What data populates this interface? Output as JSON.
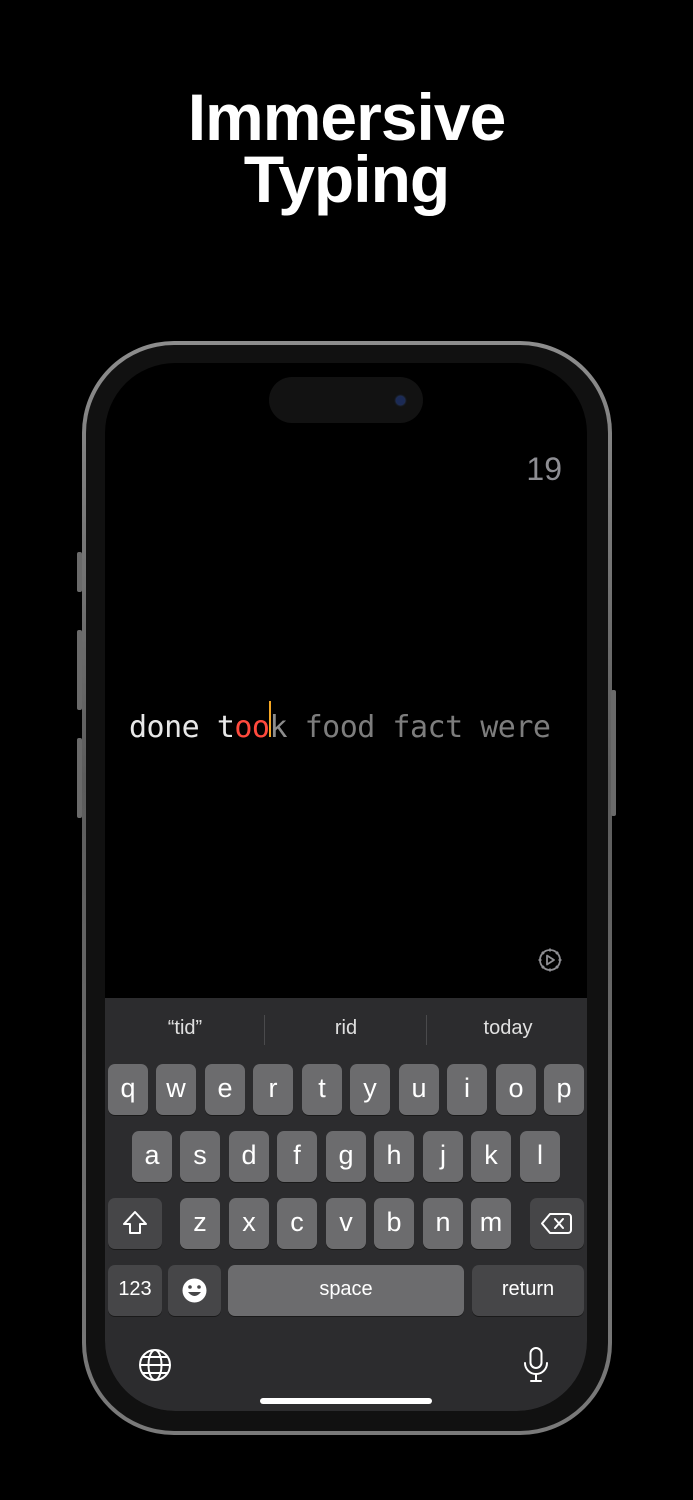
{
  "headline": [
    "Immersive",
    "Typing"
  ],
  "counter": "19",
  "typing": {
    "done_word": "done",
    "current_typed": "t",
    "current_error": "oo",
    "current_rest": "k",
    "upcoming": "food fact were"
  },
  "suggestions": [
    "“tid”",
    "rid",
    "today"
  ],
  "keyboard": {
    "row1": [
      "q",
      "w",
      "e",
      "r",
      "t",
      "y",
      "u",
      "i",
      "o",
      "p"
    ],
    "row2": [
      "a",
      "s",
      "d",
      "f",
      "g",
      "h",
      "j",
      "k",
      "l"
    ],
    "row3": [
      "z",
      "x",
      "c",
      "v",
      "b",
      "n",
      "m"
    ],
    "numbers_label": "123",
    "space_label": "space",
    "return_label": "return"
  },
  "colors": {
    "error": "#ff4a3d",
    "caret": "#f5a623",
    "upcoming": "#8d8d8d"
  },
  "icons": [
    "settings-gear-icon",
    "shift-icon",
    "backspace-icon",
    "emoji-icon",
    "globe-icon",
    "microphone-icon"
  ]
}
